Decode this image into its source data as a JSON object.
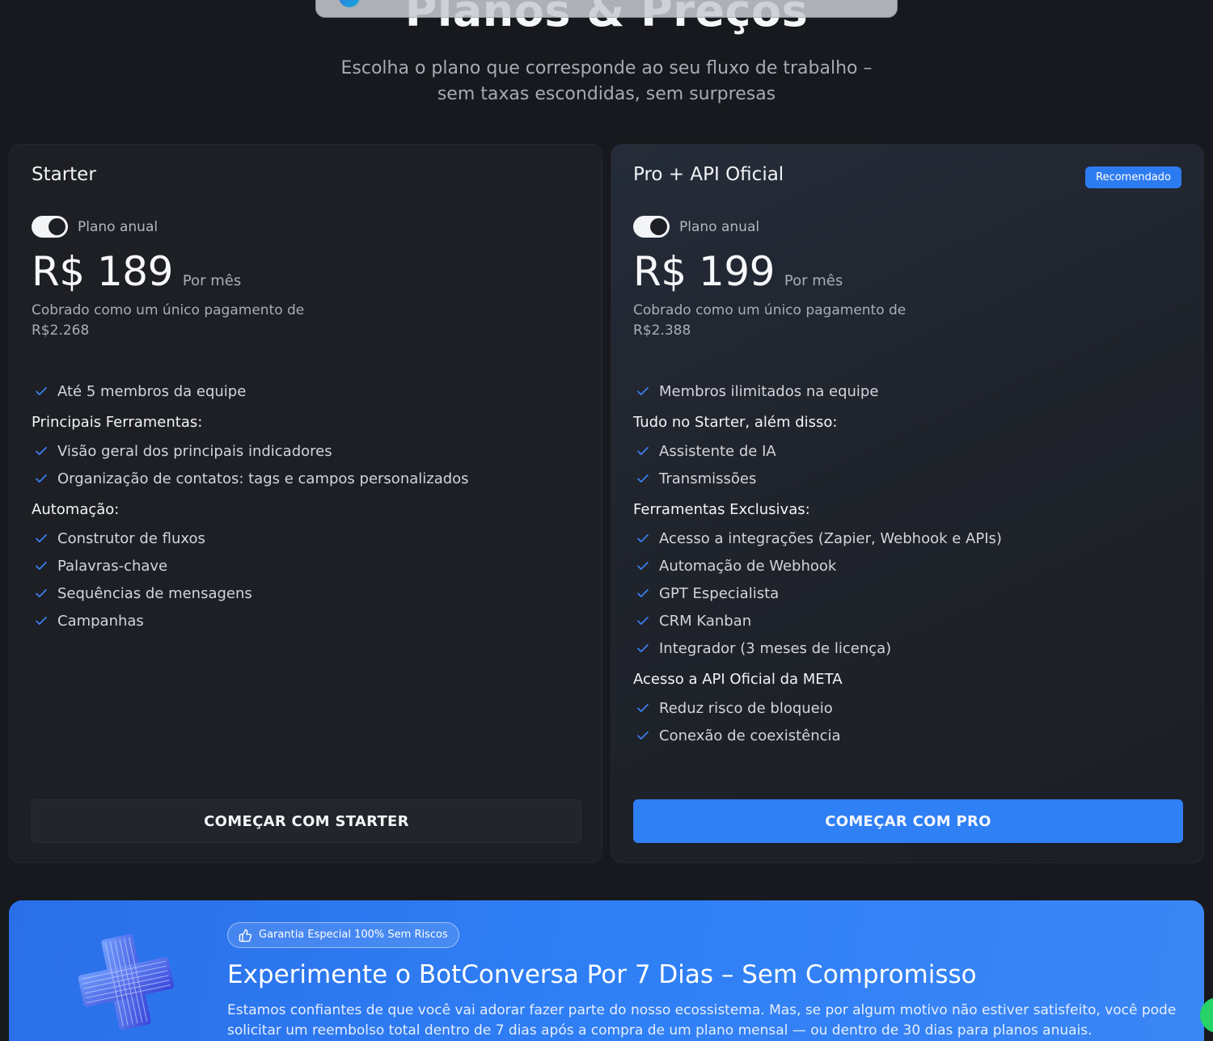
{
  "hero": {
    "title": "Planos & Preços",
    "subtitle": "Escolha o plano que corresponde ao seu fluxo de trabalho – sem taxas escondidas, sem surpresas"
  },
  "plans": [
    {
      "name": "Starter",
      "toggle_label": "Plano anual",
      "price": "R$ 189",
      "period": "Por mês",
      "billing": "Cobrado como um único pagamento de R$2.268",
      "features": [
        {
          "type": "item",
          "text": "Até 5 membros da equipe"
        },
        {
          "type": "group",
          "text": "Principais Ferramentas:"
        },
        {
          "type": "item",
          "text": "Visão geral dos principais indicadores"
        },
        {
          "type": "item",
          "text": "Organização de contatos: tags e campos personalizados"
        },
        {
          "type": "group",
          "text": "Automação:"
        },
        {
          "type": "item",
          "text": "Construtor de fluxos"
        },
        {
          "type": "item",
          "text": "Palavras-chave"
        },
        {
          "type": "item",
          "text": "Sequências de mensagens"
        },
        {
          "type": "item",
          "text": "Campanhas"
        }
      ],
      "cta": "COMEÇAR COM STARTER"
    },
    {
      "name": "Pro + API Oficial",
      "badge": "Recomendado",
      "toggle_label": "Plano anual",
      "price": "R$ 199",
      "period": "Por mês",
      "billing": "Cobrado como um único pagamento de R$2.388",
      "features": [
        {
          "type": "item",
          "text": "Membros ilimitados na equipe"
        },
        {
          "type": "group",
          "text": "Tudo no Starter, além disso:"
        },
        {
          "type": "item",
          "text": "Assistente de IA"
        },
        {
          "type": "item",
          "text": "Transmissões"
        },
        {
          "type": "group",
          "text": "Ferramentas Exclusivas:"
        },
        {
          "type": "item",
          "text": "Acesso a integrações (Zapier, Webhook e APIs)"
        },
        {
          "type": "item",
          "text": "Automação de Webhook"
        },
        {
          "type": "item",
          "text": "GPT Especialista"
        },
        {
          "type": "item",
          "text": "CRM Kanban"
        },
        {
          "type": "item",
          "text": "Integrador (3 meses de licença)"
        },
        {
          "type": "group",
          "text": "Acesso a API Oficial da META"
        },
        {
          "type": "item",
          "text": "Reduz risco de bloqueio"
        },
        {
          "type": "item",
          "text": "Conexão de coexistência"
        }
      ],
      "cta": "COMEÇAR COM PRO"
    }
  ],
  "guarantee": {
    "pill": "Garantia Especial 100% Sem Riscos",
    "title": "Experimente o BotConversa Por 7 Dias – Sem Compromisso",
    "text": "Estamos confiantes de que você vai adorar fazer parte do nosso ecossistema. Mas, se por algum motivo não estiver satisfeito, você pode solicitar um reembolso total dentro de 7 dias após a compra de um plano mensal — ou dentro de 30 dias para planos anuais."
  },
  "colors": {
    "background": "#17191e",
    "card": "#1d1f25",
    "accent": "#2f7ff5",
    "check": "#3b82f6"
  },
  "icons": {
    "check": "check-icon",
    "thumb": "thumbs-up-icon",
    "whatsapp": "whatsapp-icon"
  }
}
